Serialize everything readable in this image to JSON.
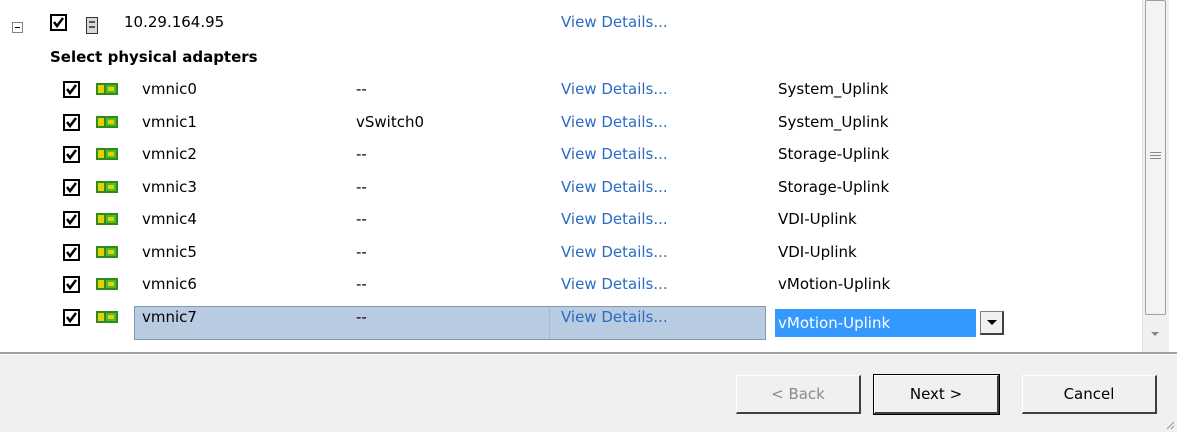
{
  "host": {
    "name": "10.29.164.95",
    "details_label": "View Details..."
  },
  "section_title": "Select physical adapters",
  "adapters": [
    {
      "name": "vmnic0",
      "switch": "--",
      "details": "View Details...",
      "uplink": "System_Uplink"
    },
    {
      "name": "vmnic1",
      "switch": "vSwitch0",
      "details": "View Details...",
      "uplink": "System_Uplink"
    },
    {
      "name": "vmnic2",
      "switch": "--",
      "details": "View Details...",
      "uplink": "Storage-Uplink"
    },
    {
      "name": "vmnic3",
      "switch": "--",
      "details": "View Details...",
      "uplink": "Storage-Uplink"
    },
    {
      "name": "vmnic4",
      "switch": "--",
      "details": "View Details...",
      "uplink": "VDI-Uplink"
    },
    {
      "name": "vmnic5",
      "switch": "--",
      "details": "View Details...",
      "uplink": "VDI-Uplink"
    },
    {
      "name": "vmnic6",
      "switch": "--",
      "details": "View Details...",
      "uplink": "vMotion-Uplink"
    },
    {
      "name": "vmnic7",
      "switch": "--",
      "details": "View Details...",
      "uplink": "vMotion-Uplink"
    }
  ],
  "selected_index": 7,
  "buttons": {
    "back": "< Back",
    "next": "Next >",
    "cancel": "Cancel"
  },
  "colors": {
    "link": "#2a6bc5",
    "selection": "#b8cbe0",
    "dropdown_highlight": "#3399ff"
  }
}
